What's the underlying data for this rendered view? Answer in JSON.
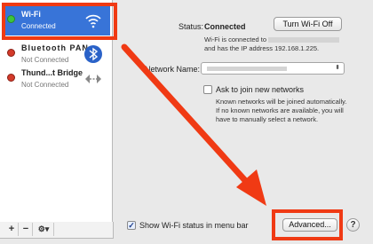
{
  "sidebar": {
    "services": [
      {
        "name": "Wi-Fi",
        "status": "Connected",
        "icon": "wifi-icon",
        "dot_color": "#3cc43c"
      },
      {
        "name": "Bluetooth PAN",
        "status": "Not Connected",
        "icon": "bluetooth-icon",
        "dot_color": "#d33a2a"
      },
      {
        "name": "Thund...t Bridge",
        "status": "Not Connected",
        "icon": "thunderbolt-bridge-icon",
        "dot_color": "#d33a2a"
      }
    ],
    "toolbar": {
      "add_label": "+",
      "remove_label": "−",
      "action_label": "⚙▾"
    }
  },
  "main": {
    "status_label": "Status:",
    "status_value": "Connected",
    "turn_off_button": "Turn Wi-Fi Off",
    "status_detail_line1_prefix": "Wi-Fi is connected to",
    "status_detail_line2": "and has the IP address 192.168.1.225.",
    "network_name_label": "Network Name:",
    "network_name_value": "",
    "ask_join_label": "Ask to join new networks",
    "ask_join_help_line1": "Known networks will be joined automatically.",
    "ask_join_help_line2": "If no known networks are available, you will",
    "ask_join_help_line3": "have to manually select a network.",
    "show_status_label": "Show Wi-Fi status in menu bar",
    "advanced_button": "Advanced...",
    "help_button": "?"
  },
  "colors": {
    "selection": "#3874d8",
    "annotation": "#f03a14"
  }
}
